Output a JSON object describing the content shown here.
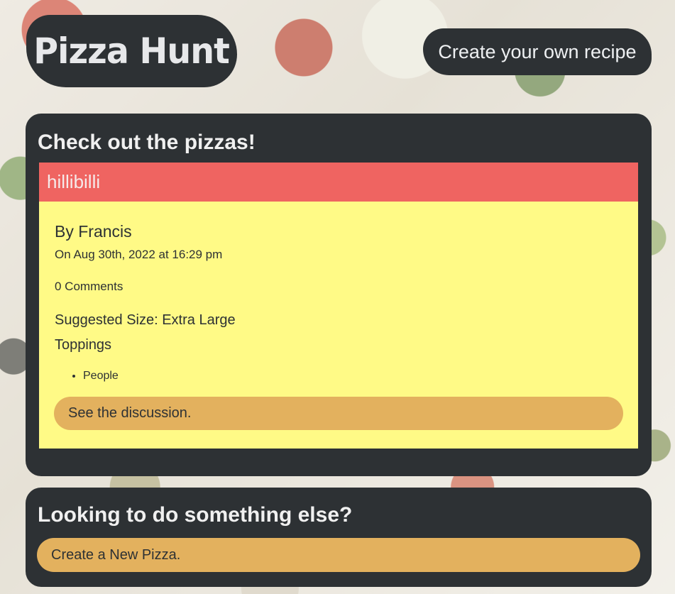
{
  "header": {
    "logo_text": "Pizza Hunt",
    "create_recipe_label": "Create your own recipe"
  },
  "pizzas_section": {
    "title": "Check out the pizzas!",
    "cards": [
      {
        "name": "hillibilli",
        "by": "By Francis",
        "date": "On Aug 30th, 2022 at 16:29 pm",
        "comments": "0 Comments",
        "size": "Suggested Size: Extra Large",
        "toppings_label": "Toppings",
        "toppings": [
          "People"
        ],
        "discussion_label": "See the discussion."
      }
    ]
  },
  "else_section": {
    "title": "Looking to do something else?",
    "new_pizza_label": "Create a New Pizza."
  },
  "colors": {
    "panel": "#2d3134",
    "card_header": "#ef6461",
    "card_body": "#fffa86",
    "button": "#e3b15e"
  }
}
